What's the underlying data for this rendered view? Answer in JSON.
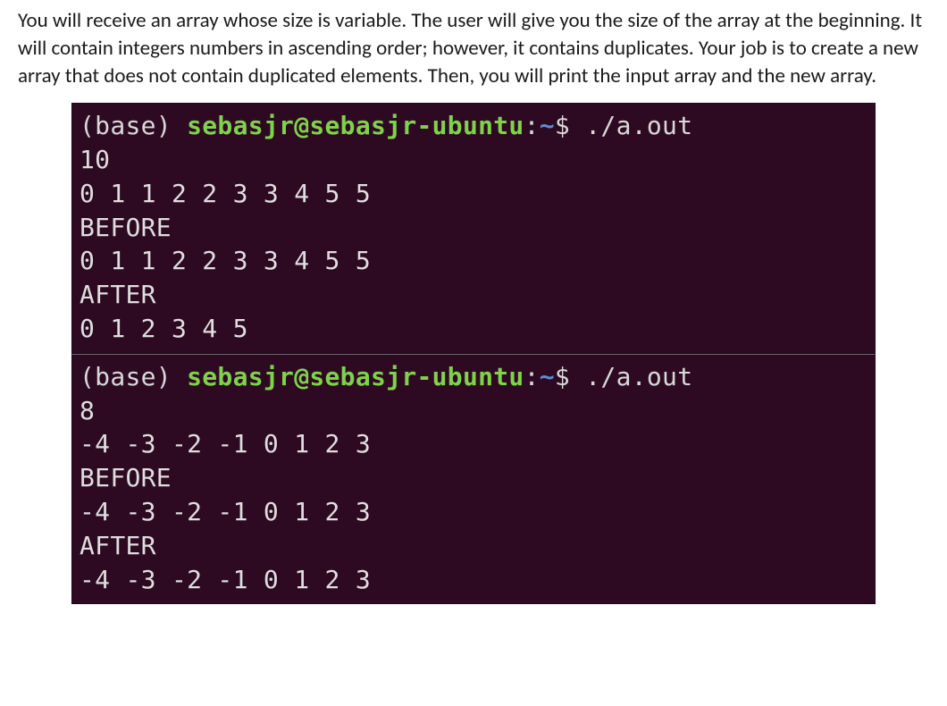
{
  "problem": {
    "text": "You will receive an array whose size is variable. The user will give you the size of the array at the beginning. It will contain integers numbers in ascending order; however, it contains duplicates. Your job is to create a new array that does not contain duplicated elements. Then, you will print the input array and the new array."
  },
  "prompt": {
    "base": "(base) ",
    "user_host": "sebasjr@sebasjr-ubuntu",
    "sep": ":",
    "cwd": "~",
    "dollar": "$ ",
    "command": "./a.out"
  },
  "runs": [
    {
      "size": "10",
      "input_line": "0 1 1 2 2 3 3 4 5 5",
      "before_label": "BEFORE",
      "before_line": "0 1 1 2 2 3 3 4 5 5",
      "after_label": "AFTER",
      "after_line": "0 1 2 3 4 5"
    },
    {
      "size": "8",
      "input_line": "-4 -3 -2 -1 0 1 2 3",
      "before_label": "BEFORE",
      "before_line": "-4 -3 -2 -1 0 1 2 3",
      "after_label": "AFTER",
      "after_line": "-4 -3 -2 -1 0 1 2 3"
    }
  ]
}
